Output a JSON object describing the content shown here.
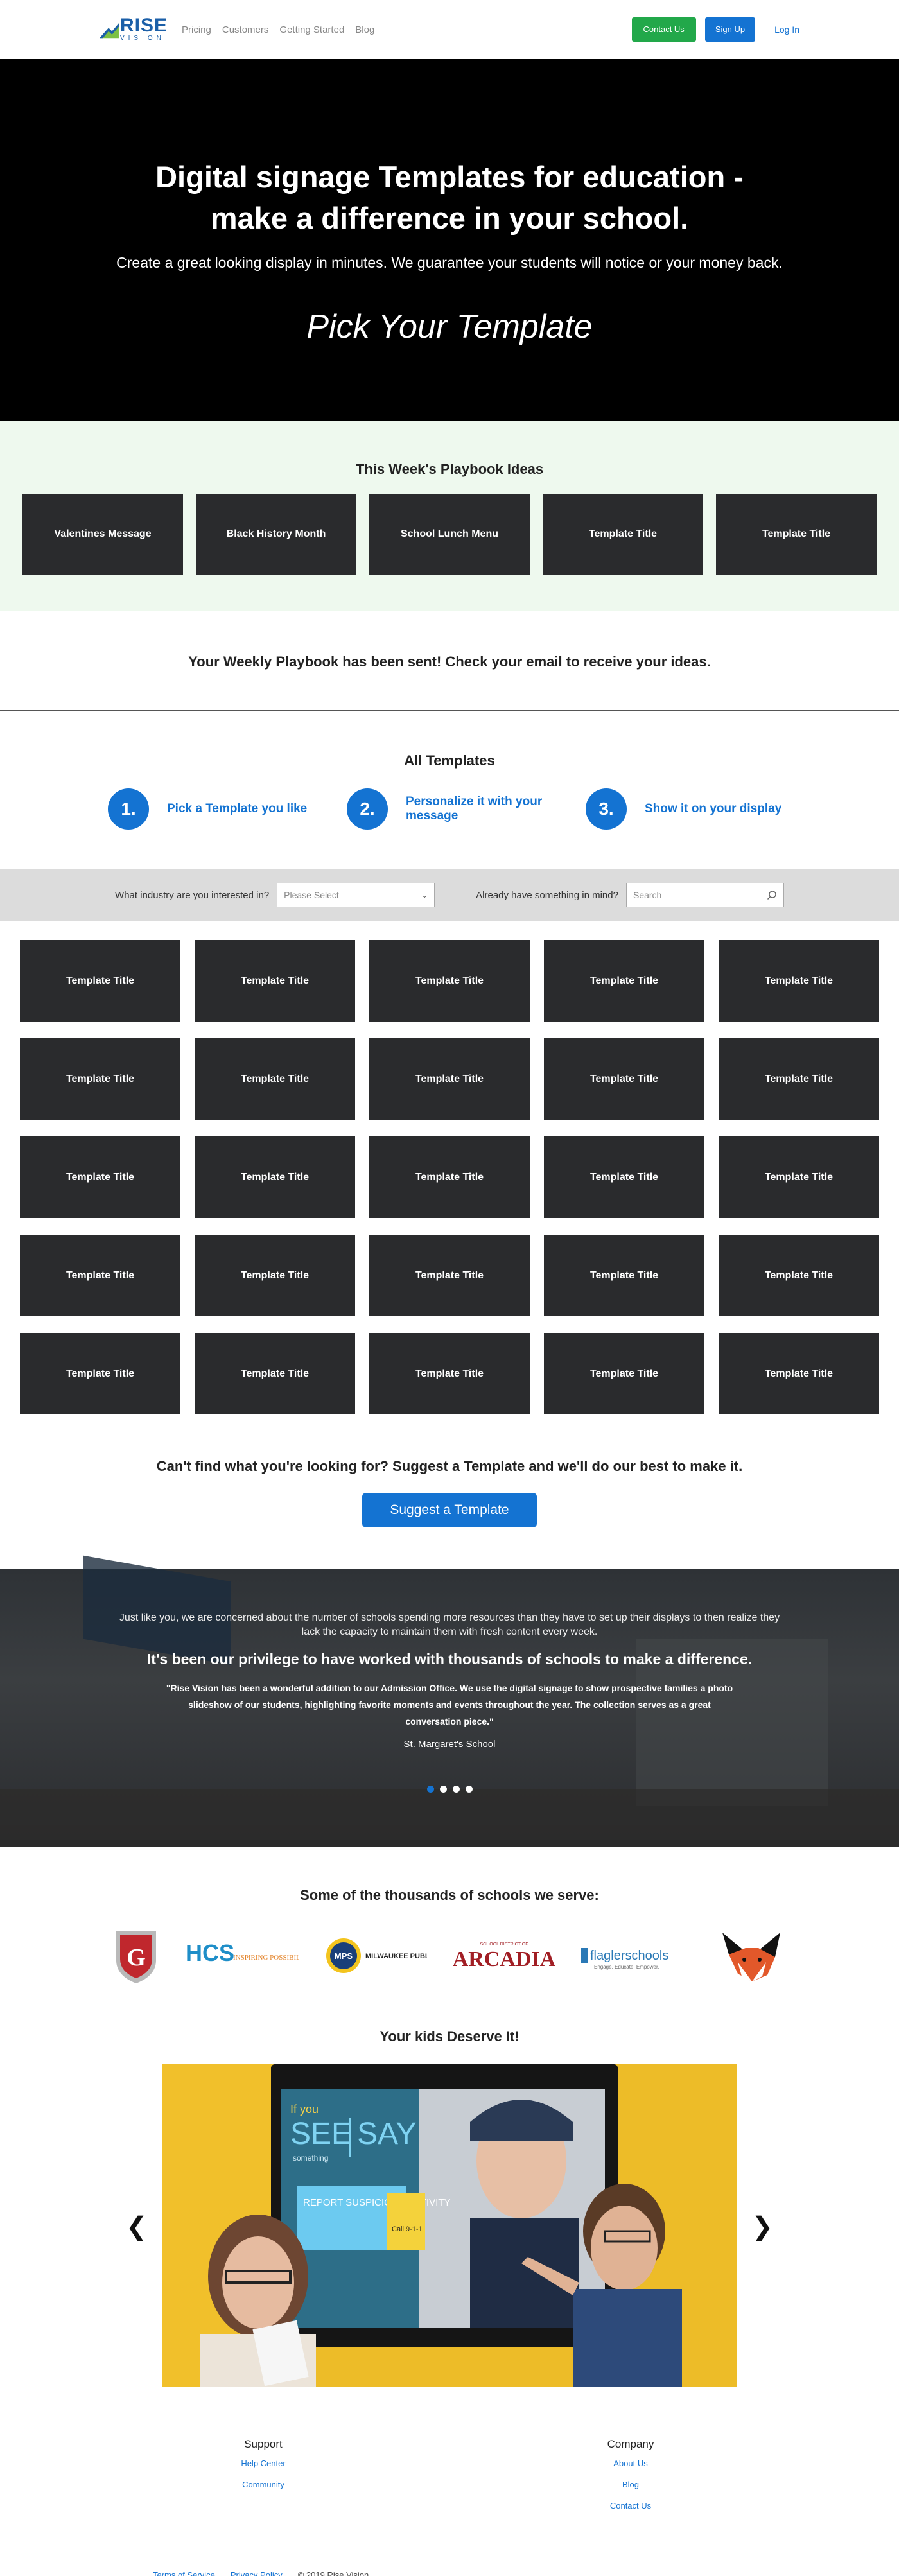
{
  "header": {
    "logo_main": "RISE",
    "logo_sub": "VISION",
    "nav": [
      "Pricing",
      "Customers",
      "Getting Started",
      "Blog"
    ],
    "contact_label": "Contact Us",
    "signup_label": "Sign Up",
    "login_label": "Log In"
  },
  "hero": {
    "title": "Digital signage Templates for education - make a difference in your school.",
    "subtitle": "Create a great looking display in minutes. We guarantee your students will notice or your money back.",
    "pick": "Pick Your Template"
  },
  "playbook": {
    "title": "This Week's Playbook Ideas",
    "tiles": [
      "Valentines Message",
      "Black History Month",
      "School Lunch Menu",
      "Template Title",
      "Template Title"
    ]
  },
  "sent_message": "Your Weekly Playbook has been sent! Check your email to receive your ideas.",
  "all_templates": {
    "title": "All Templates",
    "steps": [
      {
        "num": "1.",
        "label": "Pick a Template you like"
      },
      {
        "num": "2.",
        "label": "Personalize it with your message"
      },
      {
        "num": "3.",
        "label": "Show it on your display"
      }
    ]
  },
  "filter": {
    "industry_label": "What industry are you interested in?",
    "industry_placeholder": "Please Select",
    "mind_label": "Already have something in mind?",
    "search_placeholder": "Search"
  },
  "grid": {
    "tiles": [
      "Template Title",
      "Template Title",
      "Template Title",
      "Template Title",
      "Template Title",
      "Template Title",
      "Template Title",
      "Template Title",
      "Template Title",
      "Template Title",
      "Template Title",
      "Template Title",
      "Template Title",
      "Template Title",
      "Template Title",
      "Template Title",
      "Template Title",
      "Template Title",
      "Template Title",
      "Template Title",
      "Template Title",
      "Template Title",
      "Template Title",
      "Template Title",
      "Template Title"
    ]
  },
  "suggest": {
    "text": "Can't find what you're looking for? Suggest a Template and we'll do our best to make it.",
    "button": "Suggest a Template"
  },
  "testimonial": {
    "intro": "Just like you, we are concerned about the number of schools spending more resources than they have to set up their displays to then realize they lack the capacity to maintain them with fresh content every week.",
    "headline": "It's been our privilege to have worked with thousands of schools to make a difference.",
    "quote": "\"Rise Vision has been a wonderful addition to our Admission Office. We use the digital signage to show prospective families a photo slideshow of our students, highlighting favorite moments and events throughout the year. The collection serves as a great conversation piece.\"",
    "author": "St. Margaret's School"
  },
  "schools": {
    "title": "Some of the thousands of schools we serve:",
    "logos": [
      {
        "text": "G"
      },
      {
        "text": "HCS",
        "tagline": "INSPIRING POSSIBILITIES"
      },
      {
        "text": "MPS",
        "side": "MILWAUKEE PUBLIC SCHOOLS"
      },
      {
        "text": "ARCADIA",
        "top": "SCHOOL DISTRICT OF"
      },
      {
        "text": "flaglerschools",
        "tagline": "Engage. Educate. Empower."
      },
      {
        "text": ""
      }
    ]
  },
  "kids": {
    "title": "Your kids Deserve It!",
    "screen_if": "If you",
    "screen_see": "SEE",
    "screen_say": "SAY",
    "screen_something": "something",
    "screen_report": "REPORT SUSPICIOUS ACTIVITY",
    "screen_call": "Call 9-1-1"
  },
  "footer": {
    "support_title": "Support",
    "support_links": [
      "Help Center",
      "Community"
    ],
    "company_title": "Company",
    "company_links": [
      "About Us",
      "Blog",
      "Contact Us"
    ],
    "terms": "Terms of Service",
    "privacy": "Privacy Policy",
    "copyright": "© 2019 Rise Vision"
  }
}
